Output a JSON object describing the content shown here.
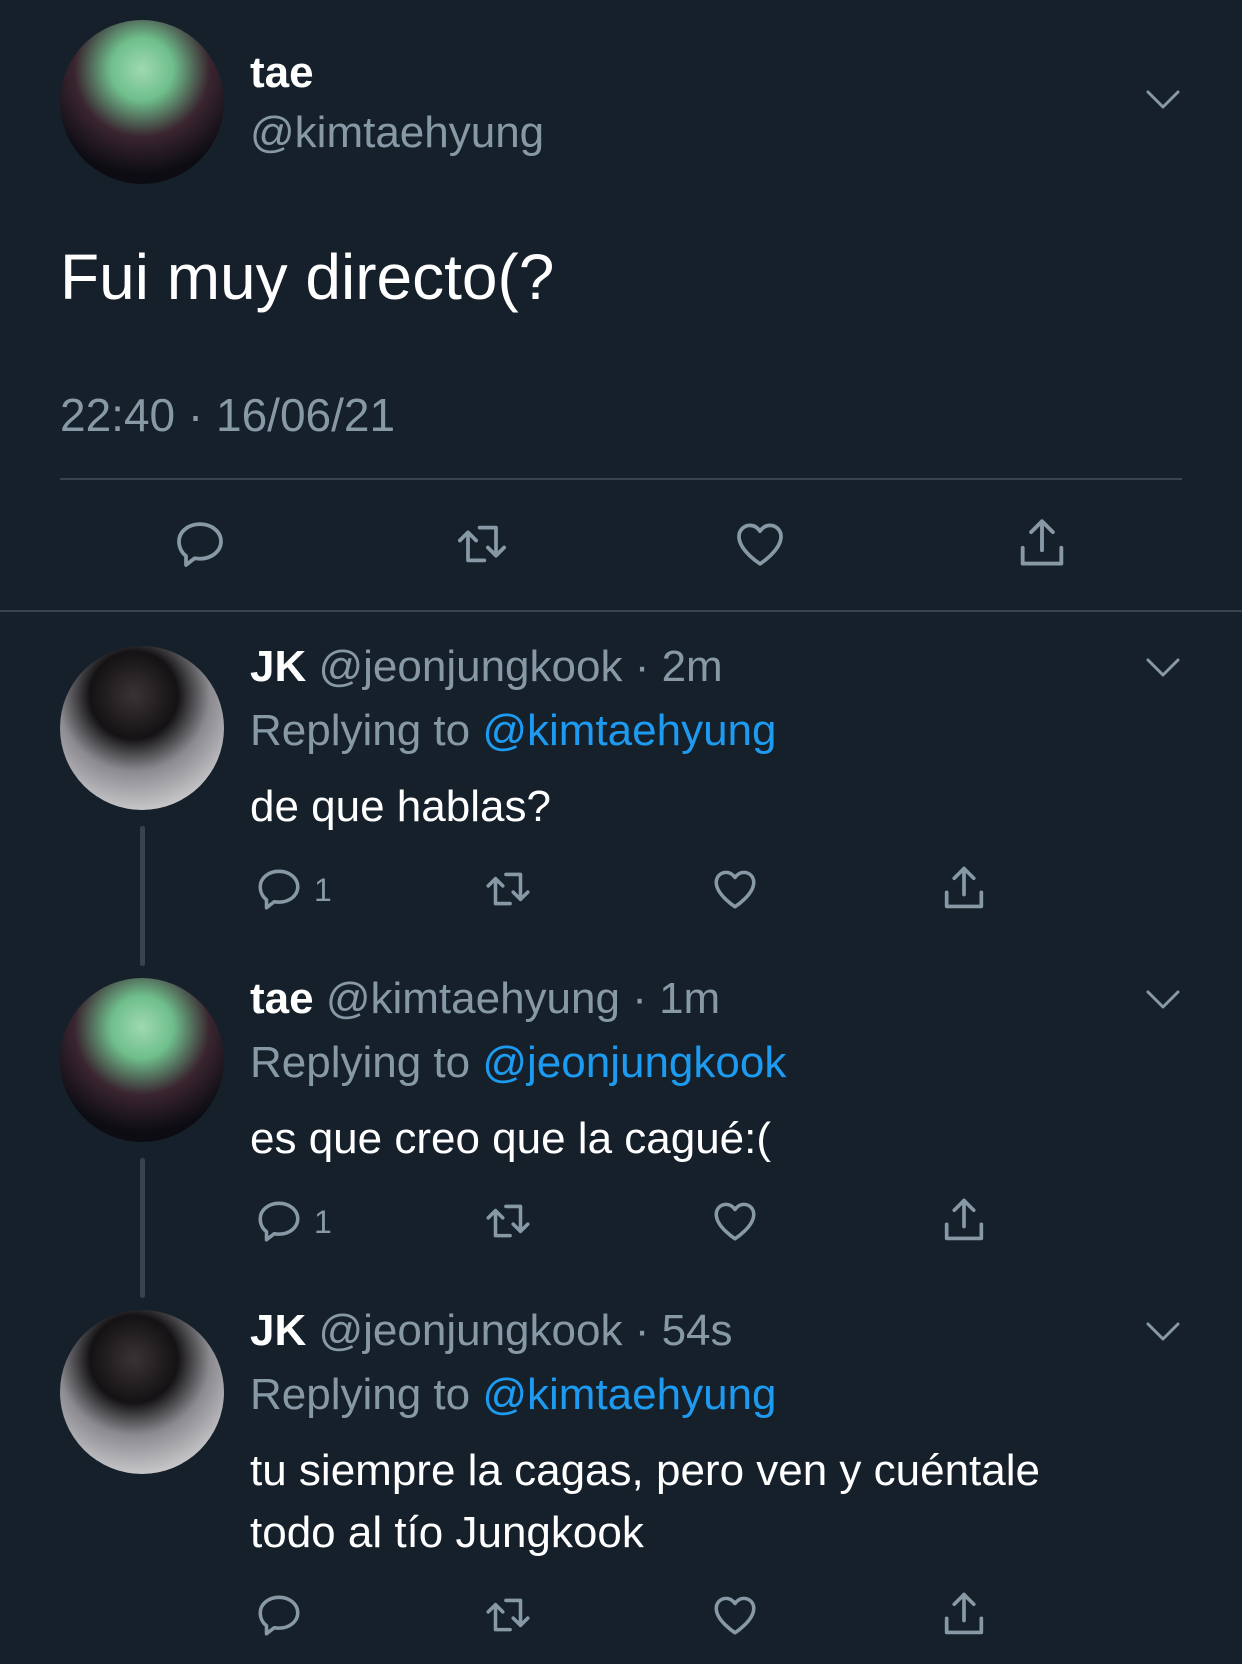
{
  "main_tweet": {
    "name": "tae",
    "handle": "@kimtaehyung",
    "text": "Fui muy directo(?",
    "timestamp": "22:40 · 16/06/21"
  },
  "replies": [
    {
      "name": "JK",
      "handle_time": "@jeonjungkook · 2m",
      "replying_prefix": "Replying to ",
      "replying_to": "@kimtaehyung",
      "text_line1": "de que hablas?",
      "reply_count": "1"
    },
    {
      "name": "tae",
      "handle_time": "@kimtaehyung · 1m",
      "replying_prefix": "Replying to ",
      "replying_to": "@jeonjungkook",
      "text_line1": "es que creo que la cagué:(",
      "reply_count": "1"
    },
    {
      "name": "JK",
      "handle_time": "@jeonjungkook · 54s",
      "replying_prefix": "Replying to ",
      "replying_to": "@kimtaehyung",
      "text_line1": "tu siempre la cagas, pero ven y cuéntale",
      "text_line2": "todo al tío Jungkook"
    }
  ],
  "icons": [
    "reply-icon",
    "retweet-icon",
    "like-icon",
    "share-icon",
    "chevron-down-icon"
  ],
  "colors": {
    "background": "#15202b",
    "text": "#ffffff",
    "muted": "#8899a6",
    "link": "#1d9bf0",
    "divider": "#38444d"
  }
}
